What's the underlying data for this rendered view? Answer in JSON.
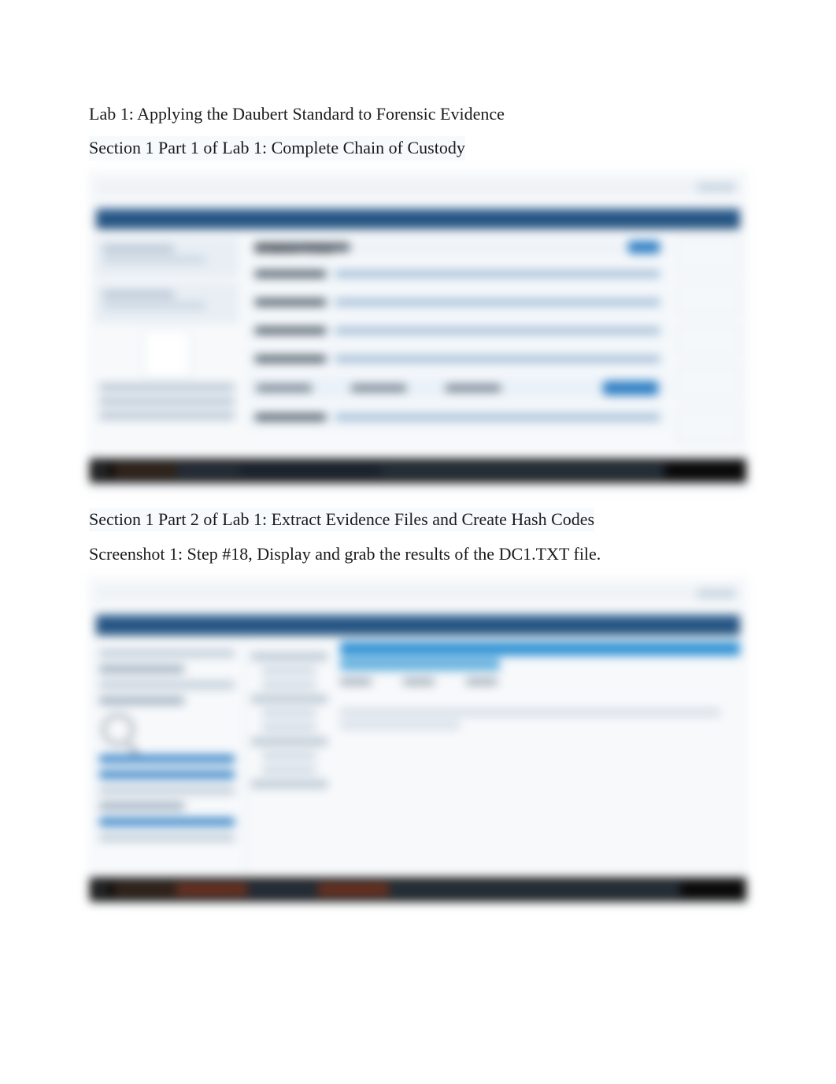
{
  "title": "Lab 1: Applying the Daubert Standard to Forensic Evidence",
  "section1": {
    "heading": "Section 1 Part 1 of Lab 1: Complete Chain of Custody"
  },
  "section2": {
    "heading": "Section 1 Part 2 of Lab 1: Extract Evidence Files and Create Hash Codes",
    "caption": "Screenshot 1: Step #18, Display and grab the results of the DC1.TXT file."
  },
  "screenshot1": {
    "description": "Browser window showing an evidence/chain-of-custody web form with a left sidebar, labeled form fields, an action button, a right details panel, and a Windows taskbar. Content is blurred and not legible.",
    "form_title_placeholder": "Evidence Form",
    "rows": [
      {
        "label": "",
        "value": ""
      },
      {
        "label": "",
        "value": ""
      },
      {
        "label": "",
        "value": ""
      },
      {
        "label": "",
        "value": ""
      }
    ],
    "table_headers": [
      "",
      "",
      ""
    ],
    "primary_button": "",
    "taskbar": "Windows taskbar"
  },
  "screenshot2": {
    "description": "Forensic tool window displaying a file tree on the left, a results pane on the right with highlighted header rows and hash/column output for DC1.TXT, and a Windows taskbar. Content is blurred and not legible.",
    "results_header_1": "",
    "results_header_2": "",
    "columns": [
      "",
      "",
      ""
    ],
    "hash_lines": [
      "",
      ""
    ],
    "taskbar": "Windows taskbar"
  }
}
